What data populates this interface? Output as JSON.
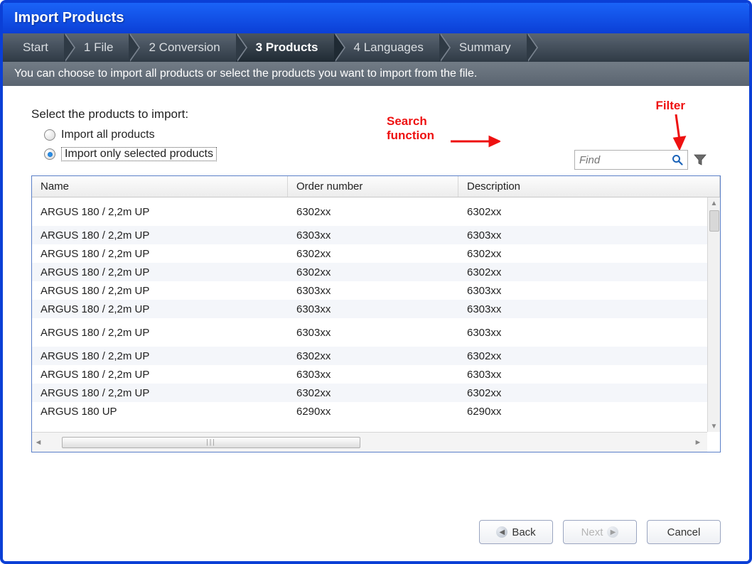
{
  "window_title": "Import Products",
  "breadcrumb": [
    {
      "label": "Start",
      "active": false
    },
    {
      "label": "1 File",
      "active": false
    },
    {
      "label": "2 Conversion",
      "active": false
    },
    {
      "label": "3 Products",
      "active": true
    },
    {
      "label": "4 Languages",
      "active": false
    },
    {
      "label": "Summary",
      "active": false
    }
  ],
  "info_text": "You can choose to import all products or select the products you want to import from the file.",
  "section_label": "Select the products to import:",
  "radio_all": "Import all products",
  "radio_selected": "Import only selected products",
  "selected_option": "selected",
  "search_placeholder": "Find",
  "annotations": {
    "search_label": "Search function",
    "filter_label": "Filter"
  },
  "columns": {
    "name": "Name",
    "order": "Order number",
    "desc": "Description"
  },
  "rows": [
    {
      "name": "ARGUS 180 / 2,2m UP",
      "order": "6302xx",
      "desc": "6302xx",
      "tall": true
    },
    {
      "name": "ARGUS 180 / 2,2m UP",
      "order": "6303xx",
      "desc": "6303xx"
    },
    {
      "name": "ARGUS 180 / 2,2m UP",
      "order": "6302xx",
      "desc": "6302xx"
    },
    {
      "name": "ARGUS 180 / 2,2m UP",
      "order": "6302xx",
      "desc": "6302xx"
    },
    {
      "name": "ARGUS 180 / 2,2m UP",
      "order": "6303xx",
      "desc": "6303xx"
    },
    {
      "name": "ARGUS 180 / 2,2m UP",
      "order": "6303xx",
      "desc": "6303xx"
    },
    {
      "name": "ARGUS 180 / 2,2m UP",
      "order": "6303xx",
      "desc": "6303xx",
      "tall": true
    },
    {
      "name": "ARGUS 180 / 2,2m UP",
      "order": "6302xx",
      "desc": "6302xx"
    },
    {
      "name": "ARGUS 180 / 2,2m UP",
      "order": "6303xx",
      "desc": "6303xx"
    },
    {
      "name": "ARGUS 180 / 2,2m UP",
      "order": "6302xx",
      "desc": "6302xx"
    },
    {
      "name": "ARGUS 180 UP",
      "order": "6290xx",
      "desc": "6290xx"
    }
  ],
  "buttons": {
    "back": "Back",
    "next": "Next",
    "cancel": "Cancel"
  }
}
